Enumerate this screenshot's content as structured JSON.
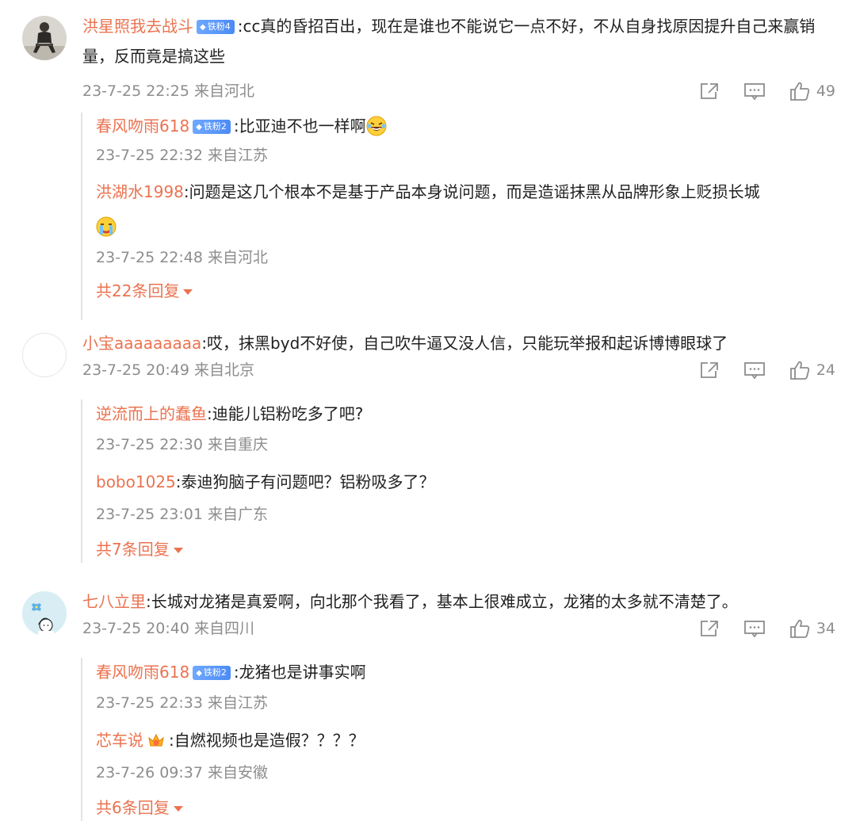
{
  "comments": [
    {
      "username": "洪星照我去战斗",
      "badge": "铁粉4",
      "text": ":cc真的昏招百出，现在是谁也不能说它一点不好，不从自身找原因提升自己来赢销量，反而竟是搞这些",
      "meta": "23-7-25 22:25 来自河北",
      "likes": "49",
      "avatar_icon": "man-sitting-avatar",
      "replies": [
        {
          "username": "春风吻雨618",
          "badge": "铁粉2",
          "text": ":比亚迪不也一样啊",
          "emoji": "laughing-tears-emoji",
          "meta": "23-7-25 22:32 来自江苏"
        },
        {
          "username": "洪湖水1998",
          "text": ":问题是这几个根本不是基于产品本身说问题，而是造谣抹黑从品牌形象上贬损长城",
          "emoji": "crying-emoji",
          "meta": "23-7-25 22:48 来自河北"
        }
      ],
      "more_replies": "共22条回复"
    },
    {
      "username": "小宝aaaaaaaaa",
      "text": ":哎，抹黑byd不好使，自己吹牛逼又没人信，只能玩举报和起诉博博眼球了",
      "meta": "23-7-25 20:49 来自北京",
      "likes": "24",
      "avatar_icon": "blank-avatar",
      "replies": [
        {
          "username": "逆流而上的蠢鱼",
          "text": ":迪能儿铝粉吃多了吧?",
          "meta": "23-7-25 22:30 来自重庆"
        },
        {
          "username": "bobo1025",
          "text": ":泰迪狗脑子有问题吧？铝粉吸多了？",
          "meta": "23-7-25 23:01 来自广东"
        }
      ],
      "more_replies": "共7条回复"
    },
    {
      "username": "七八立里",
      "text": ":长城对龙猪是真爱啊，向北那个我看了，基本上很难成立，龙猪的太多就不清楚了。",
      "meta": "23-7-25 20:40 来自四川",
      "likes": "34",
      "avatar_icon": "cartoon-boy-avatar",
      "replies": [
        {
          "username": "春风吻雨618",
          "badge": "铁粉2",
          "text": ":龙猪也是讲事实啊",
          "meta": "23-7-25 22:33 来自江苏"
        },
        {
          "username": "芯车说",
          "crown": "crown-icon",
          "text": ":自燃视频也是造假？？？？",
          "meta": "23-7-26 09:37 来自安徽"
        }
      ],
      "more_replies": "共6条回复"
    }
  ],
  "colors": {
    "username": "#eb7350",
    "badge": "#4c8bf5",
    "meta": "#8d8d8d",
    "text": "#1f1f1f"
  }
}
